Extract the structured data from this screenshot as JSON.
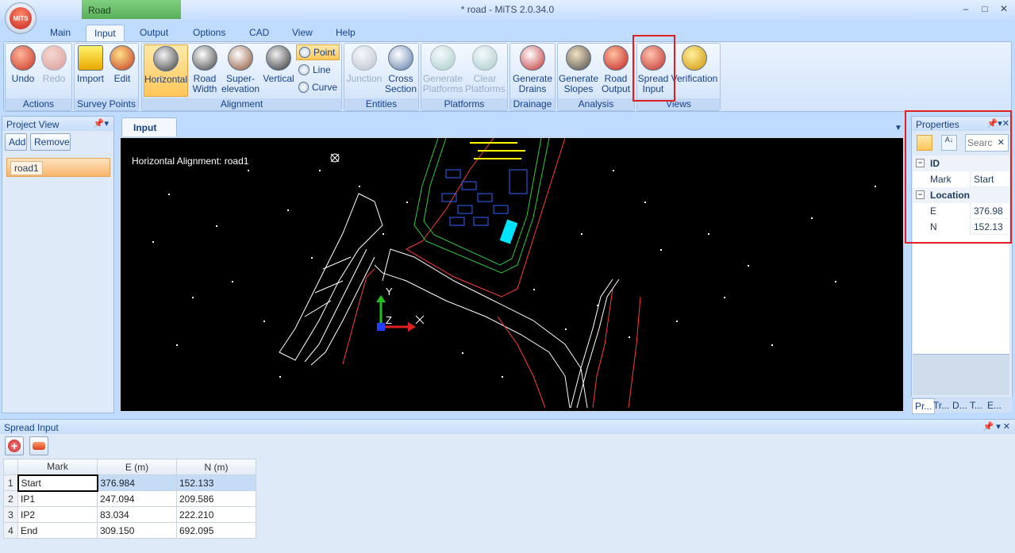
{
  "window": {
    "context_tab": "Road",
    "title": "* road - MiTS 2.0.34.0",
    "controls": [
      "–",
      "□",
      "✕"
    ],
    "orb_label": "MiTS"
  },
  "tabs": [
    {
      "label": "Main",
      "active": false
    },
    {
      "label": "Input",
      "active": true
    },
    {
      "label": "Output",
      "active": false
    },
    {
      "label": "Options",
      "active": false
    },
    {
      "label": "CAD",
      "active": false
    },
    {
      "label": "View",
      "active": false
    },
    {
      "label": "Help",
      "active": false
    }
  ],
  "ribbon": {
    "actions": {
      "label": "Actions",
      "undo": "Undo",
      "redo": "Redo"
    },
    "survey": {
      "label": "Survey Points",
      "import": "Import",
      "edit": "Edit"
    },
    "alignment": {
      "label": "Alignment",
      "horizontal": "Horizontal",
      "road_width": "Road Width",
      "superelevation": "Super- elevation",
      "vertical": "Vertical",
      "point": "Point",
      "line": "Line",
      "curve": "Curve"
    },
    "entities": {
      "label": "Entities",
      "junction": "Junction",
      "cross_section": "Cross Section"
    },
    "platforms": {
      "label": "Platforms",
      "generate": "Generate Platforms",
      "clear": "Clear Platforms"
    },
    "drainage": {
      "label": "Drainage",
      "generate_drains": "Generate Drains"
    },
    "analysis": {
      "label": "Analysis",
      "generate_slopes": "Generate Slopes",
      "road_output": "Road Output"
    },
    "views": {
      "label": "Views",
      "spread_input": "Spread Input",
      "verification": "Verification"
    }
  },
  "project_view": {
    "title": "Project View",
    "add": "Add",
    "remove": "Remove",
    "items": [
      "road1"
    ]
  },
  "document": {
    "tab": "Input",
    "viewport_label": "Horizontal Alignment: road1",
    "axis_y": "Y",
    "axis_z": "Z"
  },
  "properties": {
    "title": "Properties",
    "search_placeholder": "Searc",
    "categories": [
      {
        "name": "ID",
        "rows": [
          {
            "key": "Mark",
            "value": "Start"
          }
        ]
      },
      {
        "name": "Location",
        "rows": [
          {
            "key": "E",
            "value": "376.98"
          },
          {
            "key": "N",
            "value": "152.13"
          }
        ]
      }
    ],
    "bottom_tabs": [
      "Pr...",
      "Tr...",
      "D...",
      "T...",
      "E..."
    ]
  },
  "spread_input": {
    "title": "Spread Input",
    "columns": [
      "Mark",
      "E (m)",
      "N (m)"
    ],
    "rows": [
      {
        "no": "1",
        "mark": "Start",
        "e": "376.984",
        "n": "152.133"
      },
      {
        "no": "2",
        "mark": "IP1",
        "e": "247.094",
        "n": "209.586"
      },
      {
        "no": "3",
        "mark": "IP2",
        "e": "83.034",
        "n": "222.210"
      },
      {
        "no": "4",
        "mark": "End",
        "e": "309.150",
        "n": "692.095"
      }
    ]
  },
  "colors": {
    "highlight_box": "#e02020",
    "selected_button": "#ffc65a",
    "viewport_bg": "#000000",
    "context_tab": "#58b058"
  }
}
